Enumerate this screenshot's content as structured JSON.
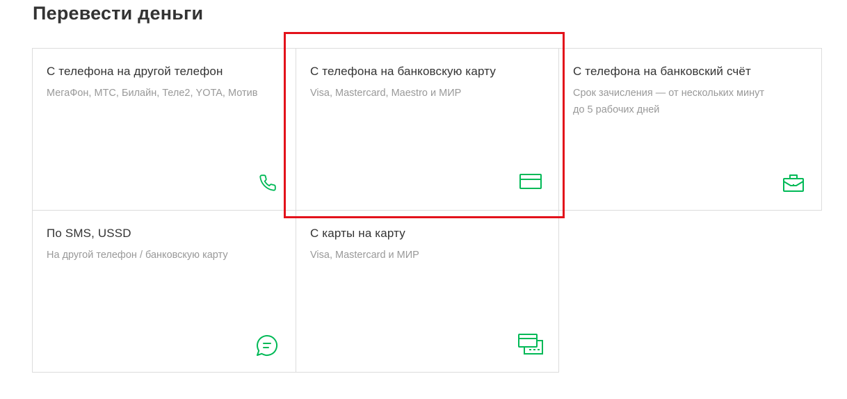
{
  "page": {
    "title": "Перевести деньги"
  },
  "cards": [
    {
      "title": "С телефона на другой телефон",
      "description": "МегаФон, МТС, Билайн, Теле2, YOTA, Мотив",
      "icon": "phone-icon"
    },
    {
      "title": "С телефона на банковскую карту",
      "description": "Visa, Mastercard, Maestro и МИР",
      "icon": "credit-card-icon"
    },
    {
      "title": "С телефона на банковский счёт",
      "description_line1": "Срок зачисления — от нескольких минут",
      "description_line2": "до 5 рабочих дней",
      "icon": "briefcase-icon"
    },
    {
      "title": "По SMS, USSD",
      "description": "На другой телефон / банковскую карту",
      "icon": "chat-bubble-icon"
    },
    {
      "title": "С карты на карту",
      "description": "Visa, Mastercard и МИР",
      "icon": "two-cards-icon"
    }
  ],
  "colors": {
    "accent": "#00b956",
    "highlight": "#e3121b",
    "title_text": "#333333",
    "muted_text": "#999999",
    "border": "#dcdcdc"
  }
}
